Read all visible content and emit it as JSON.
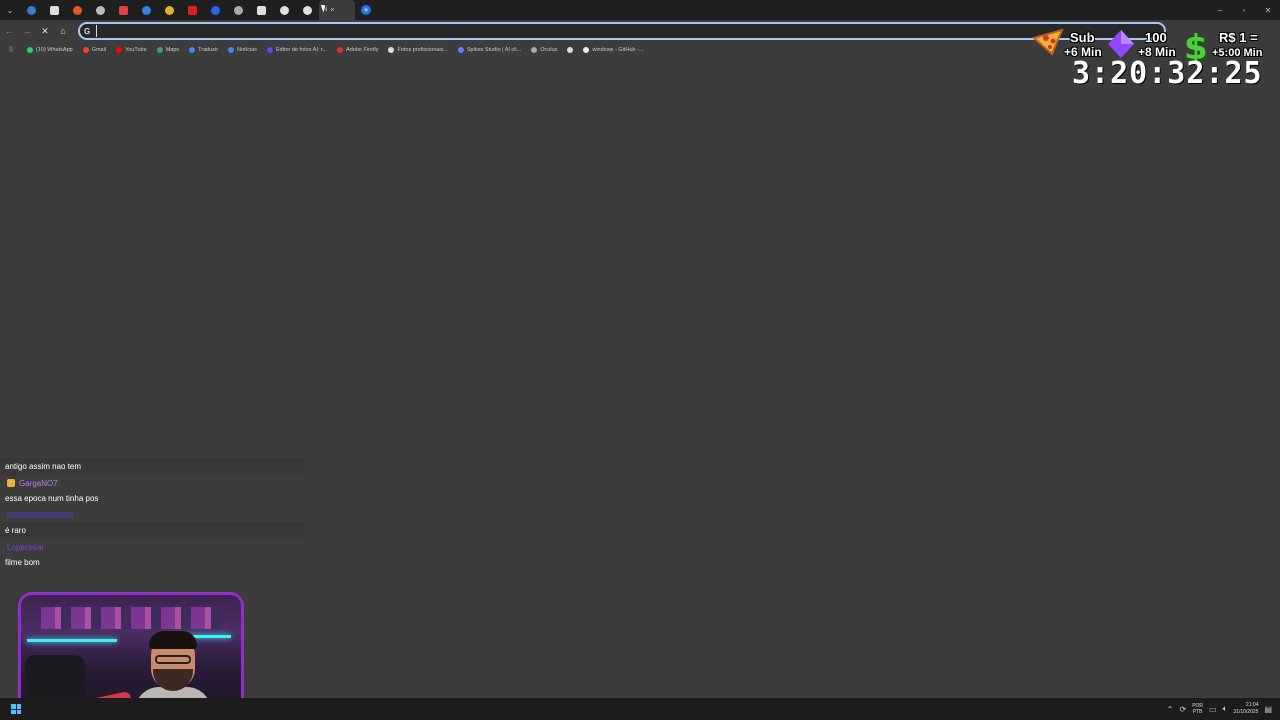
{
  "tabs": {
    "favicons": [
      "#3a7bd5",
      "#dddddd",
      "#e25b1e",
      "#bbbbbb",
      "#e14141",
      "#2f86e0",
      "#e0b030",
      "#e02020",
      "#2563eb",
      "#aaaaaa",
      "#dddddd",
      "#dddddd",
      "#dddddd"
    ],
    "active_title": "N",
    "active_close": "×",
    "new_tab_label": "+"
  },
  "toolbar": {
    "back": "←",
    "forward": "→",
    "reload": "✕",
    "home": "⌂",
    "omnibox_icon": "G",
    "omnibox_value": ""
  },
  "bookmarks": [
    {
      "label": "(10) WhatsApp",
      "color": "#25d366"
    },
    {
      "label": "Gmail",
      "color": "#ea4335"
    },
    {
      "label": "YouTube",
      "color": "#ff0000"
    },
    {
      "label": "Maps",
      "color": "#34a853"
    },
    {
      "label": "Traduzir",
      "color": "#4285f4"
    },
    {
      "label": "Notícias",
      "color": "#4285f4"
    },
    {
      "label": "Editor de fotos AI: r...",
      "color": "#6c3df2"
    },
    {
      "label": "Adobe Firefly",
      "color": "#e3322b"
    },
    {
      "label": "Fotos profissionais...",
      "color": "#dddddd"
    },
    {
      "label": "Spikes Studio | AI cli...",
      "color": "#5a7cff"
    },
    {
      "label": "Oculus",
      "color": "#aaaaaa"
    },
    {
      "label": "",
      "color": "#dddddd"
    },
    {
      "label": "windows - GitHub -...",
      "color": "#eeeeee"
    }
  ],
  "overlay": {
    "sub_label": "Sub",
    "sub_bonus": "+6 Min",
    "bits_amount": "100",
    "bits_bonus": "+8 Min",
    "money_symbol": "$",
    "money_label": "R$ 1 =",
    "money_bonus": "+5:00 Min",
    "timer": "3:20:32:25"
  },
  "chat": [
    {
      "user": "",
      "user_color": "",
      "badge": false,
      "message": "antigo assim nao tem"
    },
    {
      "user": "GargaNO7",
      "user_color": "#b37df2",
      "badge": true,
      "message": "essa epoca num tinha pos"
    },
    {
      "user": "",
      "user_color": "#5a3fe0",
      "badge": false,
      "message": "é raro"
    },
    {
      "user": "Lopecesar",
      "user_color": "#8a3dd8",
      "badge": false,
      "message": "filme bom"
    }
  ],
  "taskbar": {
    "start_label": "Start",
    "lang_top": "POR",
    "lang_bottom": "PTB",
    "time": "21:04",
    "date": "31/10/2025"
  }
}
